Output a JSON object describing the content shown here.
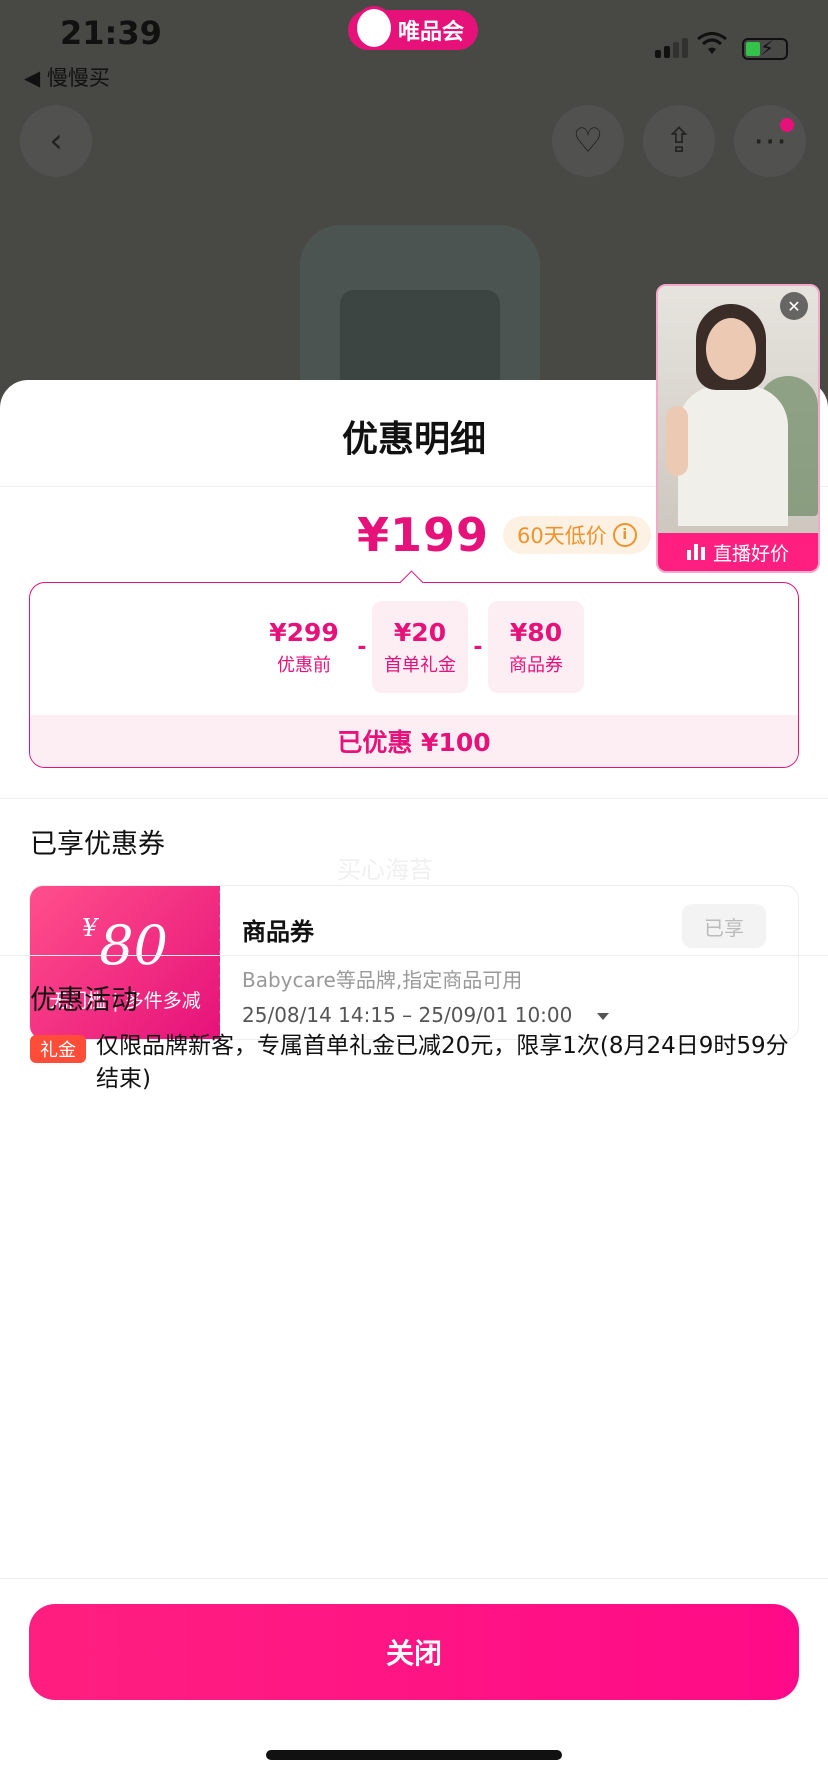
{
  "status_bar": {
    "time": "21:39",
    "back_app": "◀ 慢慢买",
    "brand": "唯品会",
    "wifi_icon": "wifi-icon",
    "battery_icon": "battery-charging-icon"
  },
  "nav": {
    "back_icon": "‹",
    "favorite_icon": "♡",
    "share_icon": "⇪",
    "more_icon": "⋯"
  },
  "sheet": {
    "title": "优惠明细"
  },
  "price": {
    "final": "¥199",
    "low_badge": "60天低价",
    "info_icon": "i"
  },
  "breakdown": {
    "items": [
      {
        "value": "¥299",
        "label": "优惠前"
      },
      {
        "value": "¥20",
        "label": "首单礼金"
      },
      {
        "value": "¥80",
        "label": "商品券"
      }
    ],
    "operators": [
      "-",
      "-"
    ],
    "saved": "已优惠 ¥100"
  },
  "coupons_section": {
    "title": "已享优惠券",
    "watermark": "买心海苔",
    "coupon": {
      "currency": "¥",
      "amount": "80",
      "condition": "无门槛 | 多件多减",
      "name": "商品券",
      "state": "已享",
      "desc": "Babycare等品牌,指定商品可用",
      "date": "25/08/14 14:15 – 25/09/01 10:00"
    }
  },
  "promo_section": {
    "title": "优惠活动",
    "tag": "礼金",
    "text": "仅限品牌新客，专属首单礼金已减20元，限享1次(8月24日9时59分结束)"
  },
  "live": {
    "label": "直播好价",
    "close_icon": "✕"
  },
  "footer": {
    "close_label": "关闭"
  },
  "colors": {
    "accent": "#e6127a",
    "badge": "#f0932b",
    "promo_tag": "#ff4d3a"
  }
}
